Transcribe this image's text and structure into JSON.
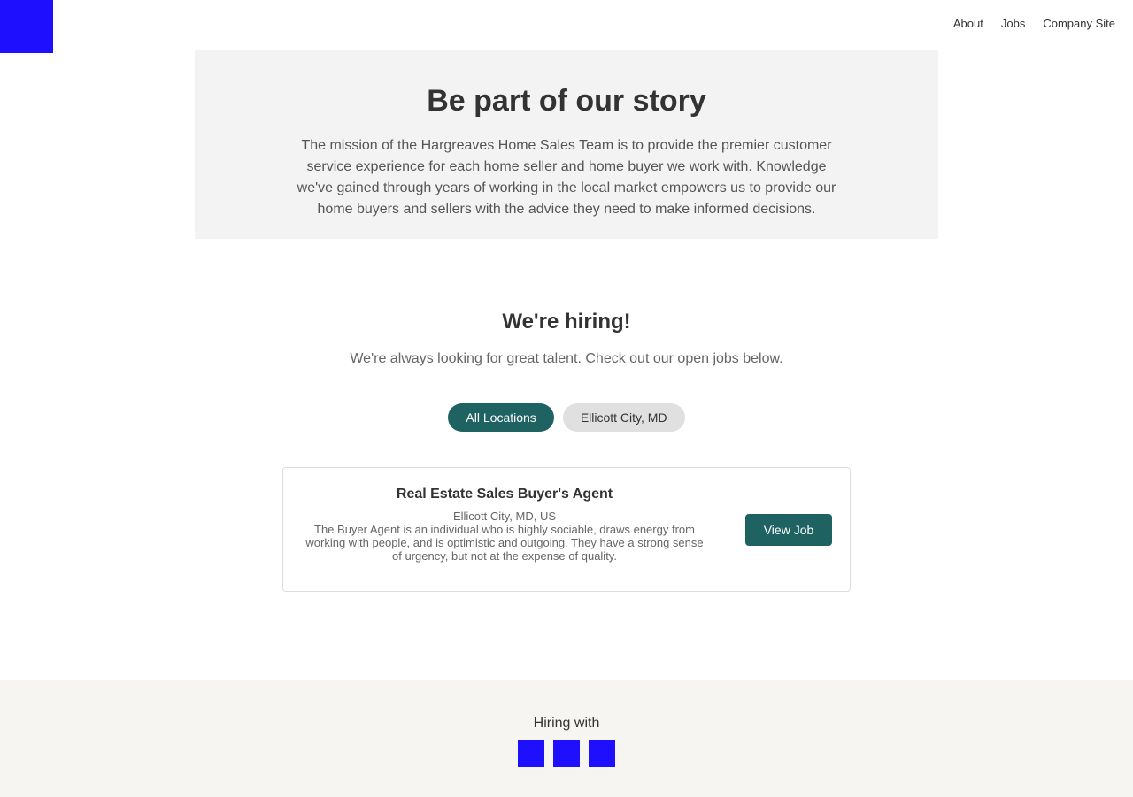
{
  "header": {
    "logo": "logo-icon",
    "nav": [
      "About",
      "Jobs",
      "Company Site"
    ]
  },
  "hero": {
    "title": "Be part of our story",
    "description": "The mission of the Hargreaves Home Sales Team is to provide the premier customer service experience for each home seller and home buyer we work with. Knowledge we've gained through years of working in the local market empowers us to provide our home buyers and sellers with the advice they need to make informed decisions."
  },
  "hiring": {
    "title": "We're hiring!",
    "subtitle": "We're always looking for great talent. Check out our open jobs below."
  },
  "filters": {
    "all": "All Locations",
    "location": "Ellicott City, MD"
  },
  "jobs": [
    {
      "title": "Real Estate Sales Buyer's Agent",
      "location": "Ellicott City, MD, US",
      "description": "The Buyer Agent is an individual who is highly sociable, draws energy from working with people, and is optimistic and outgoing. They have a strong sense of urgency, but not at the expense of quality.",
      "button": "View Job"
    }
  ],
  "footer": {
    "label": "Hiring with",
    "icons": [
      "social-icon",
      "social-icon",
      "social-icon"
    ]
  },
  "colors": {
    "accent": "#1f6262",
    "placeholder_blue": "#1e10ff",
    "hero_bg": "#f3f3f3",
    "footer_bg": "#f6f5f1"
  }
}
